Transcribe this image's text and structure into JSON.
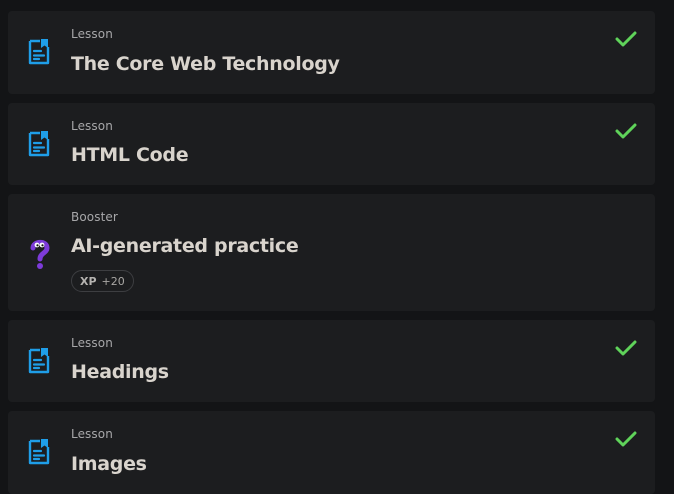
{
  "items": [
    {
      "kind": "Lesson",
      "title": "The Core Web Technology",
      "icon": "lesson-document-icon",
      "completed": true
    },
    {
      "kind": "Lesson",
      "title": "HTML Code",
      "icon": "lesson-document-icon",
      "completed": true
    },
    {
      "kind": "Booster",
      "title": "AI-generated practice",
      "icon": "question-mark-mascot-icon",
      "completed": false,
      "xp_label": "XP",
      "xp_value": "+20"
    },
    {
      "kind": "Lesson",
      "title": "Headings",
      "icon": "lesson-document-icon",
      "completed": true
    },
    {
      "kind": "Lesson",
      "title": "Images",
      "icon": "lesson-document-icon",
      "completed": true
    }
  ],
  "colors": {
    "lesson_icon": "#1f9ee8",
    "check": "#5fd35a",
    "booster_icon": "#7d3bd9",
    "card_bg": "#1c1d1f",
    "page_bg": "#131416"
  }
}
